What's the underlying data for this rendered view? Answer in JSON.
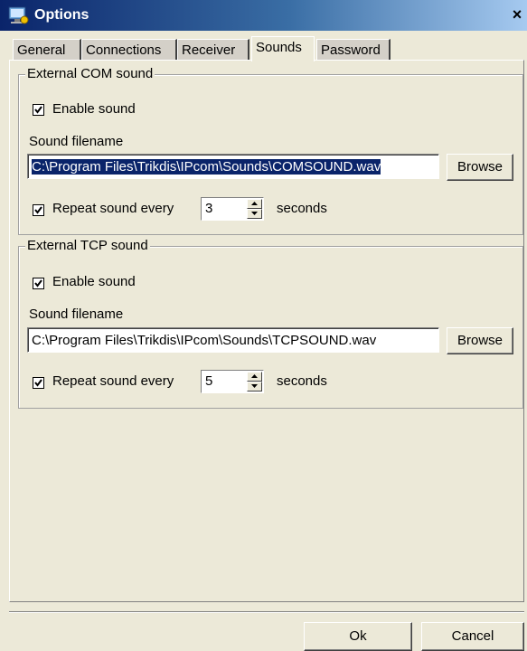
{
  "window": {
    "title": "Options",
    "close_glyph": "×"
  },
  "tabs": [
    "General",
    "Connections",
    "Receiver",
    "Sounds",
    "Password"
  ],
  "active_tab": "Sounds",
  "com_sound": {
    "caption": "External COM sound",
    "enable_label": "Enable sound",
    "enable_checked": true,
    "filename_label": "Sound filename",
    "filename_value": "C:\\Program Files\\Trikdis\\IPcom\\Sounds\\COMSOUND.wav",
    "browse_label": "Browse",
    "repeat_label": "Repeat sound every",
    "repeat_checked": true,
    "repeat_value": "3",
    "seconds_label": "seconds"
  },
  "tcp_sound": {
    "caption": "External TCP sound",
    "enable_label": "Enable sound",
    "enable_checked": true,
    "filename_label": "Sound filename",
    "filename_value": "C:\\Program Files\\Trikdis\\IPcom\\Sounds\\TCPSOUND.wav",
    "browse_label": "Browse",
    "repeat_label": "Repeat sound every",
    "repeat_checked": true,
    "repeat_value": "5",
    "seconds_label": "seconds"
  },
  "buttons": {
    "ok": "Ok",
    "cancel": "Cancel"
  }
}
